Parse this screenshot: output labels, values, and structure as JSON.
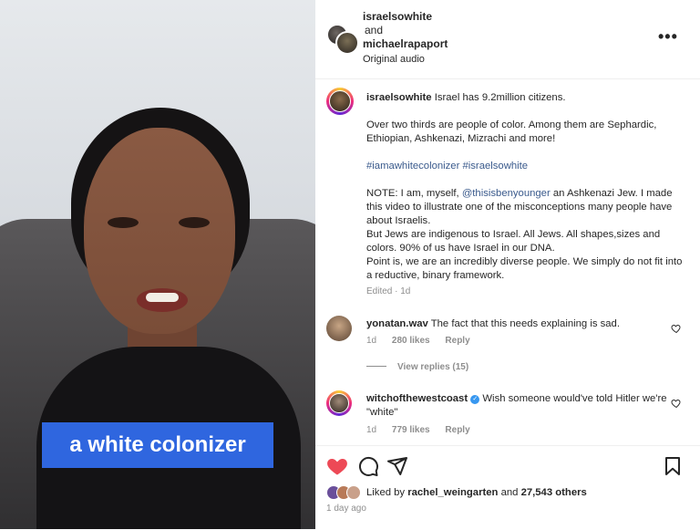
{
  "video": {
    "caption_overlay": "a white colonizer"
  },
  "header": {
    "user1": "israelsowhite",
    "and": "and",
    "user2": "michaelrapaport",
    "audio": "Original audio",
    "more": "•••"
  },
  "post_caption": {
    "username": "israelsowhite",
    "line1": "Israel has 9.2million citizens.",
    "para2": "Over two thirds are people of color. Among them are Sephardic, Ethiopian, Ashkenazi, Mizrachi and more!",
    "hashtags": "#iamawhitecolonizer #israelsowhite",
    "note_prefix": "NOTE: I am, myself,",
    "mention": "@thisisbenyounger",
    "note_suffix": "an Ashkenazi Jew. I made this video to illustrate one of the misconceptions many people have about Israelis.",
    "line_jews": "But Jews are indigenous to Israel. All Jews. All shapes,sizes and colors. 90% of us have Israel in our DNA.",
    "line_point": "Point is, we are an incredibly diverse people. We simply do not fit into a reductive, binary framework.",
    "edited": "Edited · 1d"
  },
  "comments": [
    {
      "username": "yonatan.wav",
      "text": "The fact that this needs explaining is sad.",
      "age": "1d",
      "likes": "280 likes",
      "reply": "Reply"
    },
    {
      "username": "witchofthewestcoast",
      "verified": "✓",
      "text": "Wish someone would've told Hitler we're \"white\"",
      "age": "1d",
      "likes": "779 likes",
      "reply": "Reply"
    }
  ],
  "view_replies": "View replies (15)",
  "likes": {
    "prefix": "Liked by",
    "user": "rachel_weingarten",
    "and": "and",
    "others": "27,543 others"
  },
  "date": "1 day ago",
  "colors": {
    "caption_bg": "#2f66df",
    "like_red": "#ed4956",
    "link": "#3a5a8c",
    "verified": "#3797f0"
  }
}
